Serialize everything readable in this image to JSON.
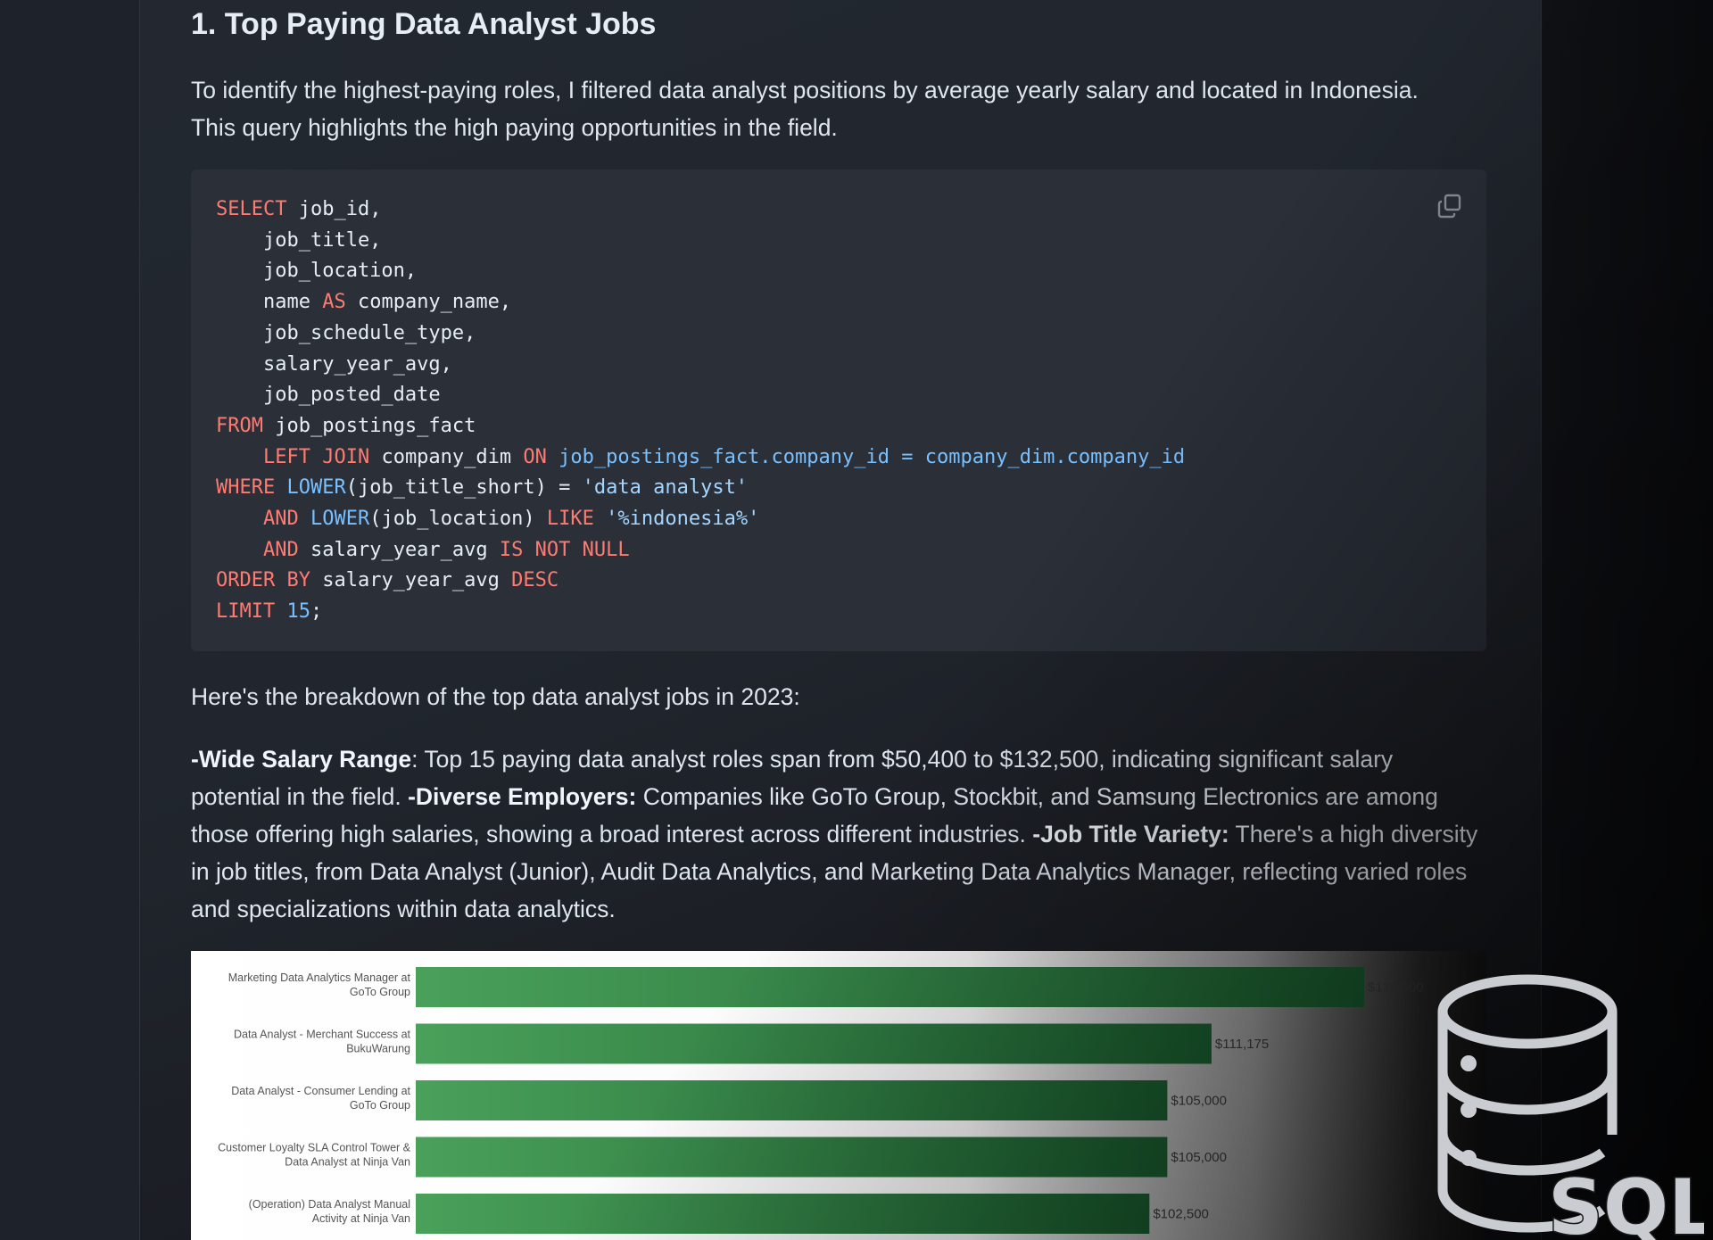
{
  "article": {
    "heading": "1. Top Paying Data Analyst Jobs",
    "intro_line1": "To identify the highest-paying roles, I filtered data analyst positions by average yearly salary and located in Indonesia.",
    "intro_line2": "This query highlights the high paying opportunities in the field.",
    "breakdown": "Here's the breakdown of the top data analyst jobs in 2023:",
    "insights": {
      "b1": "-Wide Salary Range",
      "t1": ": Top 15 paying data analyst roles span from $50,400 to $132,500, indicating significant salary potential in the field. ",
      "b2": "-Diverse Employers:",
      "t2": " Companies like GoTo Group, Stockbit, and Samsung Electronics are among those offering high salaries, showing a broad interest across different industries. ",
      "b3": "-Job Title Variety:",
      "t3": " There's a high diversity in job titles, from Data Analyst (Junior), Audit Data Analytics, and Marketing Data Analytics Manager, reflecting varied roles and specializations within data analytics."
    }
  },
  "code": {
    "copy_icon": "copy-icon",
    "l1_kw": "SELECT",
    "l1": " job_id,",
    "l2": "    job_title,",
    "l3": "    job_location,",
    "l4a": "    name ",
    "l4_kw": "AS",
    "l4b": " company_name,",
    "l5": "    job_schedule_type,",
    "l6": "    salary_year_avg,",
    "l7": "    job_posted_date",
    "l8_kw": "FROM",
    "l8": " job_postings_fact",
    "l9_pre": "    ",
    "l9_kw1": "LEFT JOIN",
    "l9a": " company_dim ",
    "l9_kw2": "ON",
    "l9b": " job_postings_fact.company_id = company_dim.company_id",
    "l10_kw": "WHERE",
    "l10_sp": " ",
    "l10_fn": "LOWER",
    "l10a": "(job_title_short) = ",
    "l10_str": "'data analyst'",
    "l11_pre": "    ",
    "l11_kw": "AND",
    "l11_sp": " ",
    "l11_fn": "LOWER",
    "l11a": "(job_location) ",
    "l11_kw2": "LIKE",
    "l11_sp2": " ",
    "l11_str": "'%indonesia%'",
    "l12_pre": "    ",
    "l12_kw": "AND",
    "l12a": " salary_year_avg ",
    "l12_kw2": "IS NOT NULL",
    "l13_kw": "ORDER BY",
    "l13a": " salary_year_avg ",
    "l13_kw2": "DESC",
    "l14_kw": "LIMIT",
    "l14_sp": " ",
    "l14_num": "15",
    "l14_end": ";"
  },
  "chart_data": {
    "type": "bar",
    "orientation": "horizontal",
    "categories": [
      [
        "Marketing Data Analytics Manager at",
        "GoTo Group"
      ],
      [
        "Data Analyst - Merchant Success at",
        "BukuWarung"
      ],
      [
        "Data Analyst - Consumer Lending at",
        "GoTo Group"
      ],
      [
        "Customer Loyalty SLA Control Tower &",
        "Data Analyst at Ninja Van"
      ],
      [
        "(Operation) Data Analyst Manual",
        "Activity at Ninja Van"
      ]
    ],
    "values": [
      132500,
      111175,
      105000,
      105000,
      102500
    ],
    "labels": [
      "$132,500",
      "$111,175",
      "$105,000",
      "$105,000",
      "$102,500"
    ],
    "xlim": [
      0,
      132500
    ],
    "colors": [
      "#1a5e2f",
      "#4aa15a"
    ]
  },
  "watermark": {
    "icon": "database-icon",
    "text": "SQL"
  }
}
